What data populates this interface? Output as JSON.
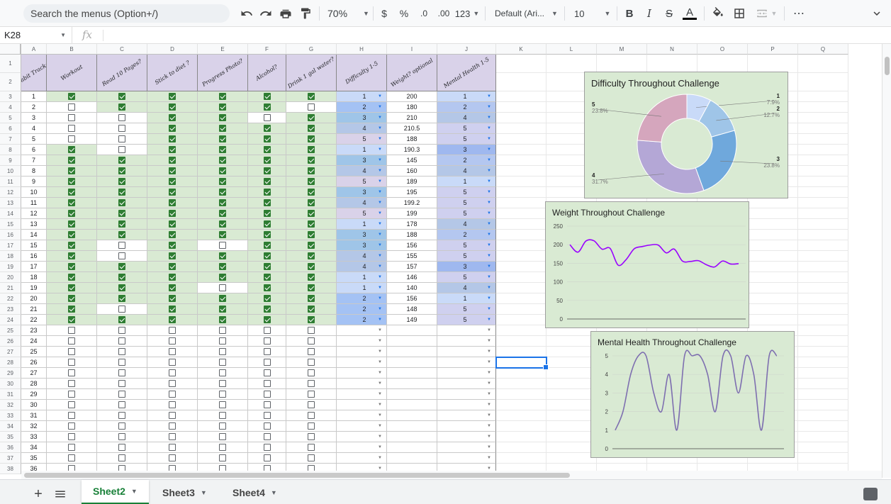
{
  "toolbar": {
    "search_placeholder": "Search the menus (Option+/)",
    "zoom": "70%",
    "currency": "$",
    "percent": "%",
    "dec_decrease": ".0",
    "dec_increase": ".00",
    "format_more": "123",
    "font": "Default (Ari...",
    "font_size": "10",
    "bold": "B",
    "italic": "I",
    "strike": "S",
    "text_color": "A",
    "more": "⋯"
  },
  "formula_bar": {
    "name_box": "K28",
    "fx": "fx"
  },
  "columns": [
    "A",
    "B",
    "C",
    "D",
    "E",
    "F",
    "G",
    "H",
    "I",
    "J",
    "K",
    "L",
    "M",
    "N",
    "O",
    "P",
    "Q"
  ],
  "headers": [
    "Habit Tracker",
    "Workout",
    "Read 10 Pages?",
    "Stick to diet ?",
    "Progress Photo?",
    "Alcohol?",
    "Drink 1 gal water?",
    "Difficulty 1-5",
    "Weight? optional",
    "Mental Health 1-5"
  ],
  "rows": [
    {
      "day": "1",
      "b": [
        1,
        1,
        1,
        1,
        1,
        1
      ],
      "h": "1",
      "w": "200",
      "m": "1"
    },
    {
      "day": "2",
      "b": [
        0,
        1,
        1,
        1,
        1,
        0
      ],
      "h": "2",
      "w": "180",
      "m": "2"
    },
    {
      "day": "3",
      "b": [
        0,
        0,
        1,
        1,
        0,
        1
      ],
      "h": "3",
      "w": "210",
      "m": "4"
    },
    {
      "day": "4",
      "b": [
        0,
        0,
        1,
        1,
        1,
        1
      ],
      "h": "4",
      "w": "210.5",
      "m": "5"
    },
    {
      "day": "5",
      "b": [
        0,
        0,
        1,
        1,
        1,
        1
      ],
      "h": "5",
      "w": "188",
      "m": "5"
    },
    {
      "day": "6",
      "b": [
        1,
        0,
        1,
        1,
        1,
        1
      ],
      "h": "1",
      "w": "190.3",
      "m": "3"
    },
    {
      "day": "7",
      "b": [
        1,
        1,
        1,
        1,
        1,
        1
      ],
      "h": "3",
      "w": "145",
      "m": "2"
    },
    {
      "day": "8",
      "b": [
        1,
        1,
        1,
        1,
        1,
        1
      ],
      "h": "4",
      "w": "160",
      "m": "4"
    },
    {
      "day": "9",
      "b": [
        1,
        1,
        1,
        1,
        1,
        1
      ],
      "h": "5",
      "w": "189",
      "m": "1"
    },
    {
      "day": "10",
      "b": [
        1,
        1,
        1,
        1,
        1,
        1
      ],
      "h": "3",
      "w": "195",
      "m": "5"
    },
    {
      "day": "11",
      "b": [
        1,
        1,
        1,
        1,
        1,
        1
      ],
      "h": "4",
      "w": "199.2",
      "m": "5"
    },
    {
      "day": "12",
      "b": [
        1,
        1,
        1,
        1,
        1,
        1
      ],
      "h": "5",
      "w": "199",
      "m": "5"
    },
    {
      "day": "13",
      "b": [
        1,
        1,
        1,
        1,
        1,
        1
      ],
      "h": "1",
      "w": "178",
      "m": "4"
    },
    {
      "day": "14",
      "b": [
        1,
        1,
        1,
        1,
        1,
        1
      ],
      "h": "3",
      "w": "188",
      "m": "2"
    },
    {
      "day": "15",
      "b": [
        1,
        0,
        1,
        0,
        1,
        1
      ],
      "h": "3",
      "w": "156",
      "m": "5"
    },
    {
      "day": "16",
      "b": [
        1,
        0,
        1,
        1,
        1,
        1
      ],
      "h": "4",
      "w": "155",
      "m": "5"
    },
    {
      "day": "17",
      "b": [
        1,
        1,
        1,
        1,
        1,
        1
      ],
      "h": "4",
      "w": "157",
      "m": "3"
    },
    {
      "day": "18",
      "b": [
        1,
        1,
        1,
        1,
        1,
        1
      ],
      "h": "1",
      "w": "146",
      "m": "5"
    },
    {
      "day": "19",
      "b": [
        1,
        1,
        1,
        0,
        1,
        1
      ],
      "h": "1",
      "w": "140",
      "m": "4"
    },
    {
      "day": "20",
      "b": [
        1,
        1,
        1,
        1,
        1,
        1
      ],
      "h": "2",
      "w": "156",
      "m": "1"
    },
    {
      "day": "21",
      "b": [
        1,
        0,
        1,
        1,
        1,
        1
      ],
      "h": "2",
      "w": "148",
      "m": "5"
    },
    {
      "day": "22",
      "b": [
        1,
        1,
        1,
        1,
        1,
        1
      ],
      "h": "2",
      "w": "149",
      "m": "5"
    }
  ],
  "empty_days": [
    "23",
    "24",
    "25",
    "26",
    "27",
    "28",
    "29",
    "30",
    "31",
    "32",
    "33",
    "34",
    "35",
    "36"
  ],
  "row_numbers": [
    "1",
    "2",
    "3",
    "4",
    "5",
    "6",
    "7",
    "8",
    "9",
    "10",
    "11",
    "12",
    "13",
    "14",
    "15",
    "16",
    "17",
    "18",
    "19",
    "20",
    "21",
    "22",
    "23",
    "24",
    "25",
    "26",
    "27",
    "28",
    "29",
    "30",
    "31",
    "32",
    "33",
    "34",
    "35",
    "36",
    "37",
    "38"
  ],
  "colors": {
    "header_bg": "#d9d2e9",
    "green_bg": "#d9ead3",
    "check_green": "#2e7d32",
    "active_tab": "#188038",
    "selection": "#1a73e8"
  },
  "chart_data": [
    {
      "type": "pie",
      "title": "Difficulty Throughout Challenge",
      "donut": true,
      "categories": [
        "1",
        "2",
        "3",
        "4",
        "5"
      ],
      "values": [
        7.9,
        12.7,
        23.8,
        31.7,
        23.8
      ],
      "value_labels": [
        "7.9%",
        "12.7%",
        "23.8%",
        "31.7%",
        "23.8%"
      ],
      "colors": [
        "#c9daf8",
        "#9fc5e8",
        "#6fa8dc",
        "#b4a7d6",
        "#d5a6bd"
      ]
    },
    {
      "type": "line",
      "title": "Weight Throughout Challenge",
      "x": [
        1,
        2,
        3,
        4,
        5,
        6,
        7,
        8,
        9,
        10,
        11,
        12,
        13,
        14,
        15,
        16,
        17,
        18,
        19,
        20,
        21,
        22
      ],
      "values": [
        200,
        180,
        210,
        210.5,
        188,
        190.3,
        145,
        160,
        189,
        195,
        199.2,
        199,
        178,
        188,
        156,
        155,
        157,
        146,
        140,
        156,
        148,
        149
      ],
      "yticks": [
        "250",
        "200",
        "150",
        "100",
        "50",
        "0"
      ],
      "ylim": [
        0,
        250
      ],
      "color": "#9900ff"
    },
    {
      "type": "line",
      "title": "Mental Health Throughout Challenge",
      "x": [
        1,
        2,
        3,
        4,
        5,
        6,
        7,
        8,
        9,
        10,
        11,
        12,
        13,
        14,
        15,
        16,
        17,
        18,
        19,
        20,
        21,
        22
      ],
      "values": [
        1,
        2,
        4,
        5,
        5,
        3,
        2,
        4,
        1,
        5,
        5,
        5,
        4,
        2,
        5,
        5,
        3,
        5,
        4,
        1,
        5,
        5
      ],
      "yticks": [
        "5",
        "4",
        "3",
        "2",
        "1",
        "0"
      ],
      "ylim": [
        0,
        5
      ],
      "color": "#7e6fb0"
    }
  ],
  "sheets": [
    "Sheet2",
    "Sheet3",
    "Sheet4"
  ]
}
